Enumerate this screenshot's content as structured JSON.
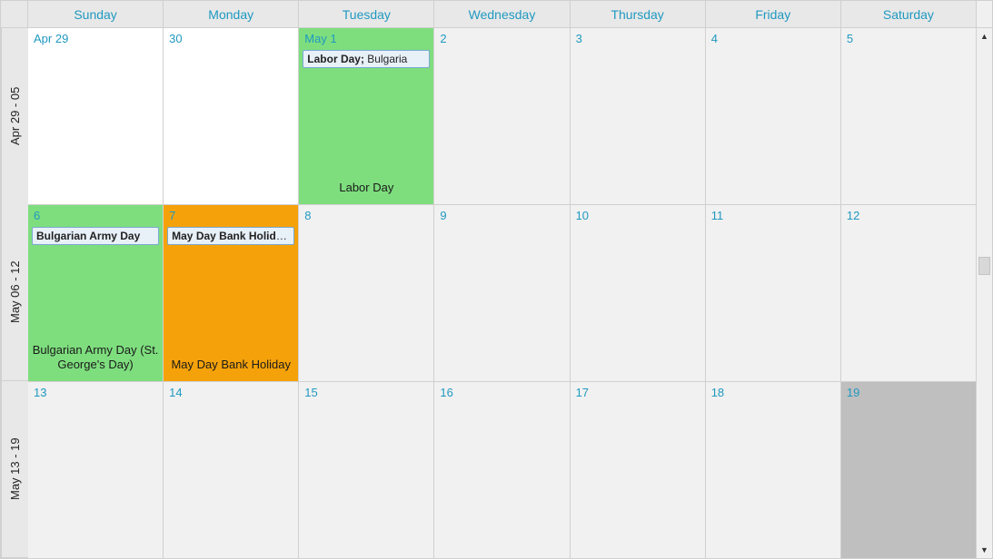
{
  "dayHeaders": [
    "Sunday",
    "Monday",
    "Tuesday",
    "Wednesday",
    "Thursday",
    "Friday",
    "Saturday"
  ],
  "weeks": [
    {
      "label": "Apr 29 - 05",
      "days": [
        {
          "date": "Apr 29",
          "bg": "white"
        },
        {
          "date": "30",
          "bg": "white"
        },
        {
          "date": "May 1",
          "bg": "green",
          "footer": "Labor Day",
          "event": {
            "bold": "Labor Day;",
            "rest": " Bulgaria"
          }
        },
        {
          "date": "2",
          "bg": "default"
        },
        {
          "date": "3",
          "bg": "default"
        },
        {
          "date": "4",
          "bg": "default"
        },
        {
          "date": "5",
          "bg": "default"
        }
      ]
    },
    {
      "label": "May 06 - 12",
      "days": [
        {
          "date": "6",
          "bg": "green",
          "footer": "Bulgarian Army Day (St. George's Day)",
          "event": {
            "bold": "Bulgarian Army Day",
            "rest": ""
          }
        },
        {
          "date": "7",
          "bg": "orange",
          "footer": "May Day Bank Holiday",
          "event": {
            "bold": "May Day Bank Holiday;",
            "rest": ""
          }
        },
        {
          "date": "8",
          "bg": "default"
        },
        {
          "date": "9",
          "bg": "default"
        },
        {
          "date": "10",
          "bg": "default"
        },
        {
          "date": "11",
          "bg": "default"
        },
        {
          "date": "12",
          "bg": "default"
        }
      ]
    },
    {
      "label": "May 13 - 19",
      "days": [
        {
          "date": "13",
          "bg": "default"
        },
        {
          "date": "14",
          "bg": "default"
        },
        {
          "date": "15",
          "bg": "default"
        },
        {
          "date": "16",
          "bg": "default"
        },
        {
          "date": "17",
          "bg": "default"
        },
        {
          "date": "18",
          "bg": "default"
        },
        {
          "date": "19",
          "bg": "today"
        }
      ]
    }
  ],
  "colors": {
    "accent": "#2099c0",
    "green": "#7ede7e",
    "orange": "#f5a20a",
    "today": "#bfbfbf"
  }
}
